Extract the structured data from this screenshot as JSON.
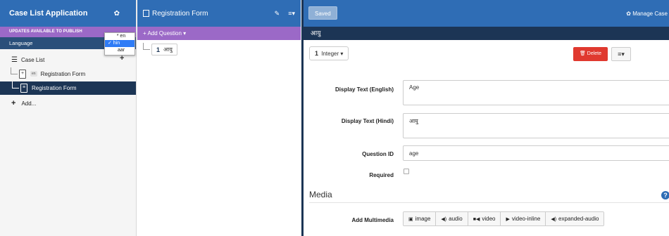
{
  "sidebar": {
    "app_title": "Case List Application",
    "updates_banner": "UPDATES AVAILABLE TO PUBLISH",
    "language_label": "Language",
    "language_options": [
      "* en",
      "✓ hin",
      "aar"
    ],
    "items": [
      {
        "label": "Case List",
        "icon": "hamburger-icon",
        "action": "+"
      },
      {
        "label": "Registration Form",
        "badge": "en",
        "icon": "document-icon"
      },
      {
        "label": "Registration Form",
        "icon": "document-icon",
        "selected": true
      }
    ],
    "add_label": "Add..."
  },
  "form_panel": {
    "title": "Registration Form",
    "add_question_label": "+ Add Question ▾",
    "questions": [
      {
        "number": "1",
        "label": "आयु"
      }
    ]
  },
  "editor": {
    "saved_label": "Saved",
    "manage_case_label": "✿ Manage Case",
    "question_title": "आयु",
    "type_number": "1",
    "type_label": "Integer ▾",
    "delete_label": "🗑 Delete",
    "menu_label": "≡▾",
    "display_text_en_label": "Display Text (English)",
    "display_text_en_value": "Age",
    "display_text_hi_label": "Display Text (Hindi)",
    "display_text_hi_value": "आयु",
    "question_id_label": "Question ID",
    "question_id_value": "age",
    "required_label": "Required",
    "media_heading": "Media",
    "add_multimedia_label": "Add Multimedia",
    "multimedia_buttons": [
      {
        "icon": "image-icon",
        "glyph": "▣",
        "label": "image"
      },
      {
        "icon": "audio-icon",
        "glyph": "◀)",
        "label": "audio"
      },
      {
        "icon": "video-icon",
        "glyph": "■◀",
        "label": "video"
      },
      {
        "icon": "play-icon",
        "glyph": "▶",
        "label": "video-inline"
      },
      {
        "icon": "audio-icon",
        "glyph": "◀)",
        "label": "expanded-audio"
      }
    ]
  },
  "colors": {
    "header_blue": "#2f6db5",
    "navy": "#1c3555",
    "purple": "#9b69c7",
    "delete_red": "#e0392f"
  }
}
